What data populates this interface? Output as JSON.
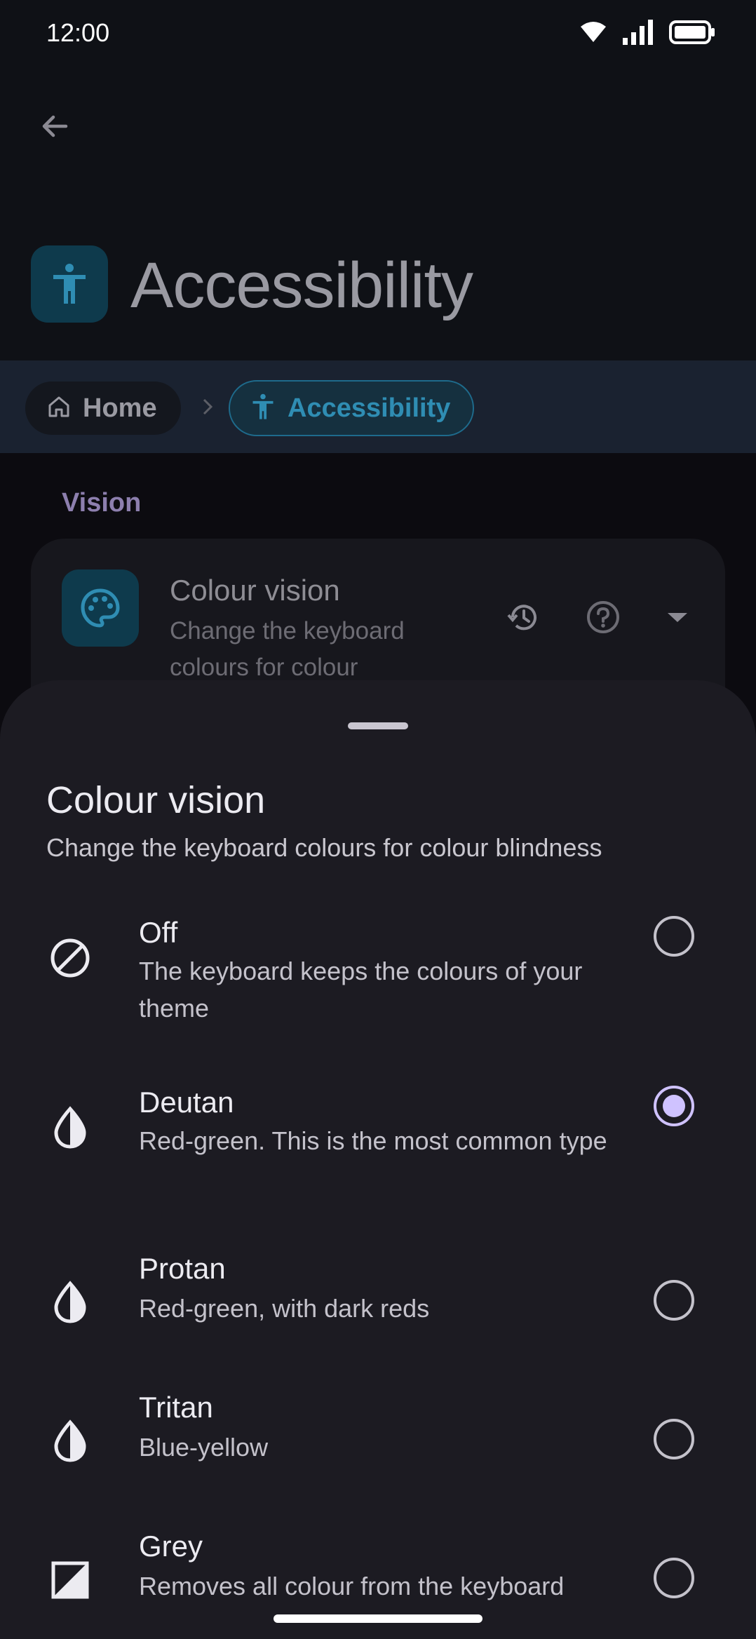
{
  "status_bar": {
    "time": "12:00"
  },
  "header": {
    "title": "Accessibility"
  },
  "breadcrumb": {
    "home_label": "Home",
    "current_label": "Accessibility"
  },
  "section": {
    "label": "Vision"
  },
  "setting_card": {
    "title": "Colour vision",
    "description": "Change the keyboard colours for colour"
  },
  "sheet": {
    "title": "Colour vision",
    "subtitle": "Change the keyboard colours for colour blindness",
    "options": [
      {
        "label": "Off",
        "description": "The keyboard keeps the colours of your theme",
        "icon": "block-icon",
        "selected": false
      },
      {
        "label": "Deutan",
        "description": "Red-green. This is the most common type",
        "icon": "contrast-drop-icon",
        "selected": true
      },
      {
        "label": "Protan",
        "description": "Red-green, with dark reds",
        "icon": "contrast-drop-icon",
        "selected": false
      },
      {
        "label": "Tritan",
        "description": "Blue-yellow",
        "icon": "contrast-drop-icon",
        "selected": false
      },
      {
        "label": "Grey",
        "description": "Removes all colour from the keyboard",
        "icon": "grayscale-icon",
        "selected": false
      }
    ]
  },
  "colors": {
    "accent": "#cfc2ff",
    "teal_accent": "#2f8db3",
    "sheet_background": "#1c1b22"
  }
}
